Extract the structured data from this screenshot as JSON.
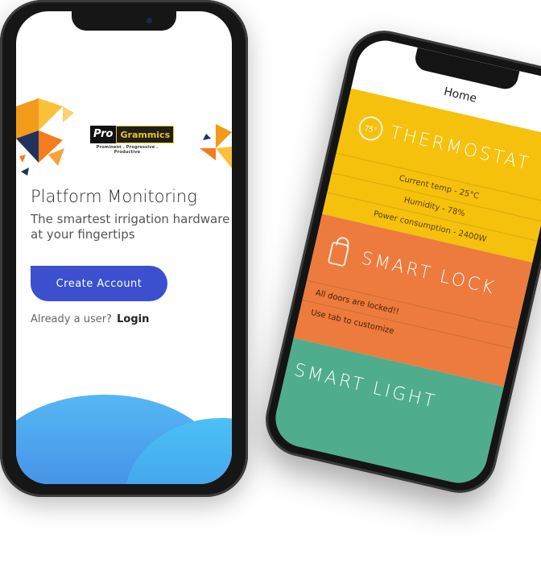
{
  "back_phone": {
    "header_title": "Home",
    "menu_icon": "hamburger-icon",
    "thermostat": {
      "title": "THERMOSTAT",
      "icon_label": "75°",
      "rows": [
        "Current temp - 25°C",
        "Humidity - 78%",
        "Power consumption - 2400W"
      ],
      "color": "#f5c10c"
    },
    "smart_lock": {
      "title": "SMART LOCK",
      "icon": "lock-icon",
      "rows": [
        "All doors are locked!!",
        "Use tab to customize"
      ],
      "color": "#ec7b3d"
    },
    "smart_light": {
      "title": "SMART LIGHT",
      "color": "#4fac8d"
    }
  },
  "front_phone": {
    "logo": {
      "pro": "Pro",
      "grammics": "Grammics",
      "tagline": "Prominent . Progressive . Productive"
    },
    "heading": "Platform Monitoring",
    "subtitle": "The smartest irrigation hardware at your fingertips",
    "create_button": "Create Account",
    "already_text": "Already a user?",
    "login_link": "Login",
    "accent_color": "#3b4fcf"
  }
}
